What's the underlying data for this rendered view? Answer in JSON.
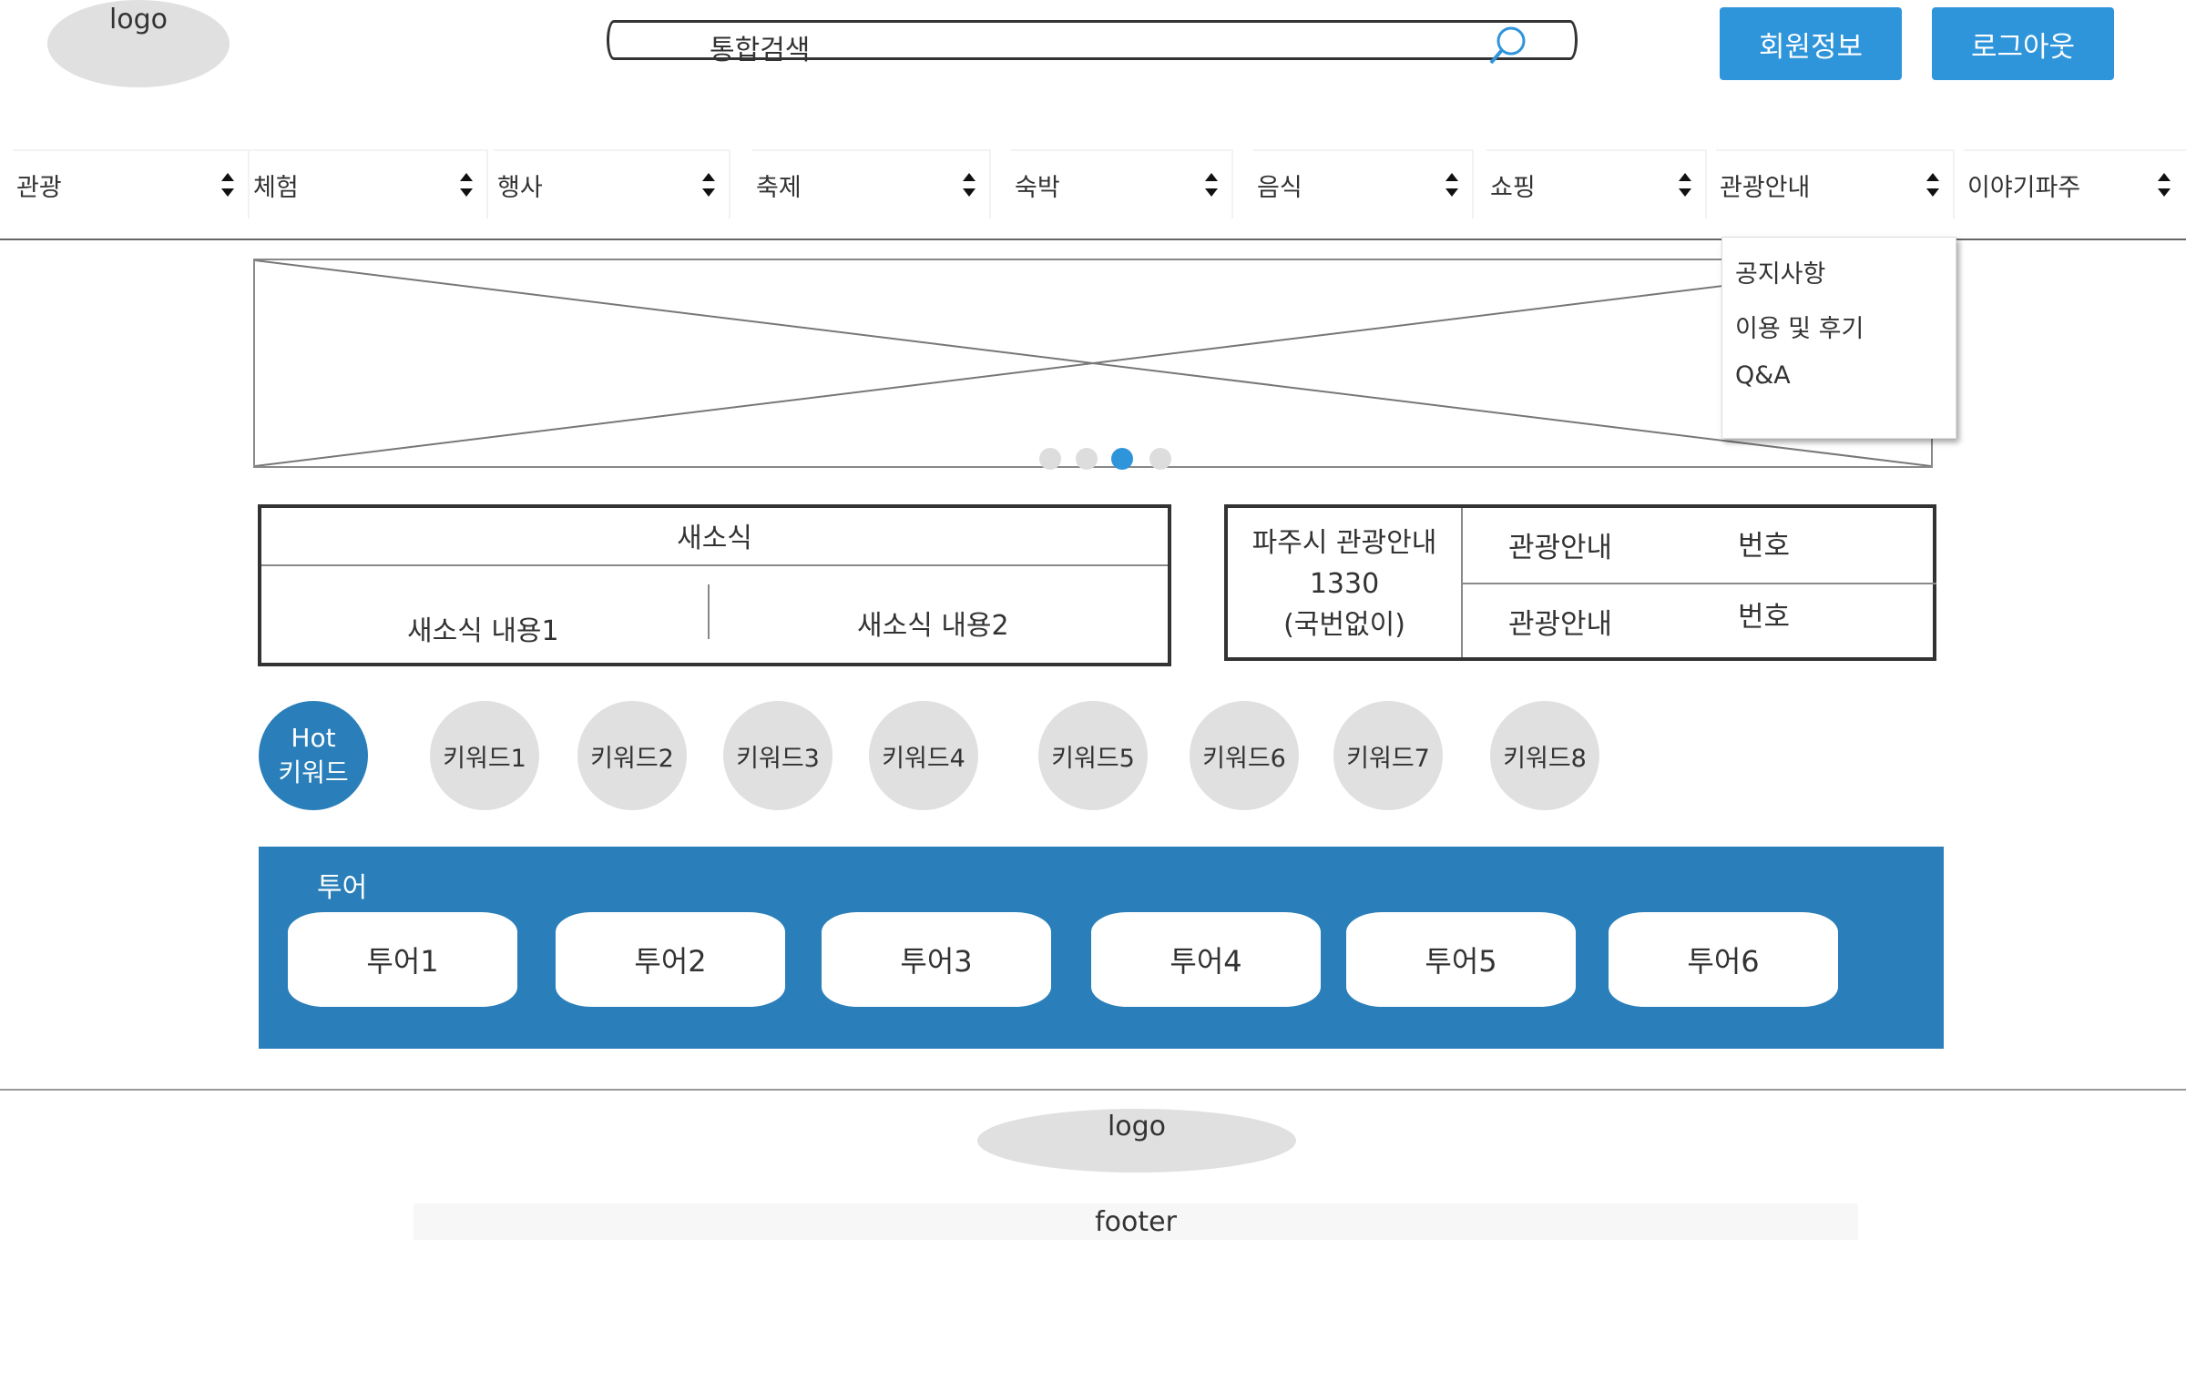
{
  "header": {
    "logo": "logo",
    "search_placeholder": "통합검색",
    "member_button": "회원정보",
    "logout_button": "로그아웃"
  },
  "nav": {
    "items": [
      "관광",
      "체험",
      "행사",
      "축제",
      "숙박",
      "음식",
      "쇼핑",
      "관광안내",
      "이야기파주"
    ]
  },
  "dropdown": {
    "items": [
      "공지사항",
      "이용 및 후기",
      "Q&A"
    ]
  },
  "carousel": {
    "slide_count": 4,
    "active_index": 2
  },
  "news": {
    "title": "새소식",
    "content1": "새소식 내용1",
    "content2": "새소식 내용2"
  },
  "info": {
    "line1": "파주시 관광안내",
    "line2": "1330",
    "line3": "(국번없이)",
    "row1_label": "관광안내",
    "row1_value": "번호",
    "row2_label": "관광안내",
    "row2_value": "번호"
  },
  "keywords": {
    "hot_line1": "Hot",
    "hot_line2": "키워드",
    "items": [
      "키워드1",
      "키워드2",
      "키워드3",
      "키워드4",
      "키워드5",
      "키워드6",
      "키워드7",
      "키워드8"
    ]
  },
  "tour": {
    "title": "투어",
    "items": [
      "투어1",
      "투어2",
      "투어3",
      "투어4",
      "투어5",
      "투어6"
    ]
  },
  "footer": {
    "logo": "logo",
    "text": "footer"
  },
  "colors": {
    "accent": "#2f95db",
    "tour_bg": "#2a7fba",
    "placeholder_gray": "#e0e0e0"
  }
}
